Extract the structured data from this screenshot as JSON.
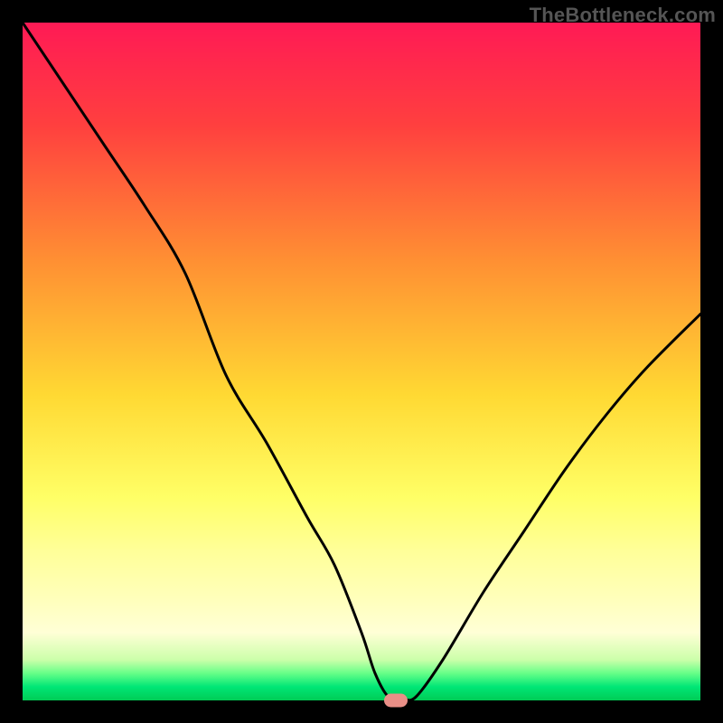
{
  "watermark": "TheBottleneck.com",
  "marker_color": "#e98f87",
  "chart_data": {
    "type": "line",
    "title": "",
    "xlabel": "",
    "ylabel": "",
    "xlim": [
      0,
      100
    ],
    "ylim": [
      0,
      100
    ],
    "grid": false,
    "legend": false,
    "background_gradient": "red-to-green (vertical, top=high risk, bottom=optimal)",
    "marker": {
      "x": 55,
      "y": 0,
      "shape": "rounded-rect",
      "color": "#e98f87"
    },
    "series": [
      {
        "name": "bottleneck-curve",
        "color": "#000000",
        "x": [
          0,
          6,
          12,
          18,
          24,
          30,
          36,
          42,
          46,
          50,
          52,
          54,
          56,
          58,
          62,
          68,
          74,
          80,
          86,
          92,
          100
        ],
        "values": [
          100,
          91,
          82,
          73,
          63,
          48,
          38,
          27,
          20,
          10,
          4,
          0.5,
          0.3,
          0.5,
          6,
          16,
          25,
          34,
          42,
          49,
          57
        ]
      }
    ],
    "notes": "Single V-shaped curve; minimum (near 0) around x≈55; left arm descends from ~100 to 0; right arm rises to ~57 at x=100. No axis ticks or labels shown."
  }
}
